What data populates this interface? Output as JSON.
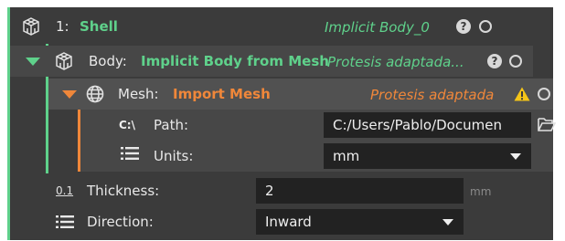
{
  "shell": {
    "index": "1:",
    "name": "Shell",
    "output_name": "Implicit Body_0",
    "help": "?",
    "icon": "lattice-cube-icon"
  },
  "body": {
    "label": "Body:",
    "name": "Implicit Body from Mesh",
    "output_name": "Protesis adaptada...",
    "help": "?",
    "icon": "lattice-cube-icon"
  },
  "mesh": {
    "label": "Mesh:",
    "name": "Import Mesh",
    "output_name": "Protesis adaptada",
    "icon": "mesh-globe-icon",
    "path": {
      "prefix_icon_text": "C:\\",
      "label": "Path:",
      "value": "C:/Users/Pablo/Documen"
    },
    "units": {
      "label": "Units:",
      "value": "mm"
    }
  },
  "thickness": {
    "icon_text": "0.1",
    "label": "Thickness:",
    "value": "2",
    "unit": "mm"
  },
  "direction": {
    "label": "Direction:",
    "value": "Inward"
  },
  "colors": {
    "green": "#5fd18b",
    "orange": "#f0873a",
    "warning": "#f5c518",
    "panel": "#3b3b3b",
    "field": "#222222"
  }
}
